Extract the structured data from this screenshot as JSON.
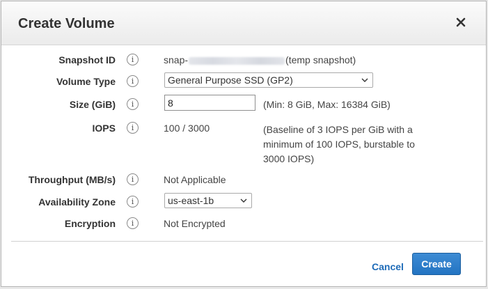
{
  "dialog": {
    "title": "Create Volume",
    "close_icon": "close-icon"
  },
  "fields": {
    "snapshot_id": {
      "label": "Snapshot ID",
      "value_prefix": "snap-",
      "value_suffix": "(temp snapshot)"
    },
    "volume_type": {
      "label": "Volume Type",
      "selected": "General Purpose SSD (GP2)"
    },
    "size": {
      "label": "Size (GiB)",
      "value": "8",
      "hint": "(Min: 8 GiB, Max: 16384 GiB)"
    },
    "iops": {
      "label": "IOPS",
      "value": "100 / 3000",
      "hint": "(Baseline of 3 IOPS per GiB with a minimum of 100 IOPS, burstable to 3000 IOPS)"
    },
    "throughput": {
      "label": "Throughput (MB/s)",
      "value": "Not Applicable"
    },
    "availability_zone": {
      "label": "Availability Zone",
      "selected": "us-east-1b"
    },
    "encryption": {
      "label": "Encryption",
      "value": "Not Encrypted"
    }
  },
  "info_icon": {
    "name": "info-icon",
    "glyph": "i"
  },
  "footer": {
    "cancel_label": "Cancel",
    "create_label": "Create"
  },
  "colors": {
    "primary": "#2374c2",
    "link": "#1e6bb8"
  }
}
